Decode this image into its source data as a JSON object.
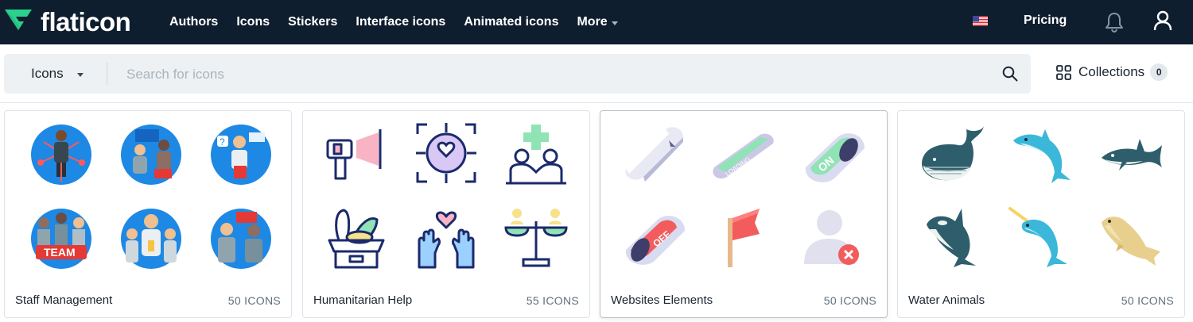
{
  "brand": {
    "name": "flaticon"
  },
  "nav": {
    "links": [
      "Authors",
      "Icons",
      "Stickers",
      "Interface icons",
      "Animated icons"
    ],
    "more_label": "More",
    "pricing_label": "Pricing"
  },
  "search": {
    "type_label": "Icons",
    "placeholder": "Search for icons",
    "value": ""
  },
  "collections": {
    "label": "Collections",
    "count": "0"
  },
  "cards": [
    {
      "title": "Staff Management",
      "count": "50 ICONS"
    },
    {
      "title": "Humanitarian Help",
      "count": "55 ICONS"
    },
    {
      "title": "Websites Elements",
      "count": "50 ICONS"
    },
    {
      "title": "Water Animals",
      "count": "50 ICONS"
    }
  ],
  "colors": {
    "nav_bg": "#0f1e2e",
    "brand_green": "#2bd18e",
    "search_bg": "#edf1f3"
  }
}
